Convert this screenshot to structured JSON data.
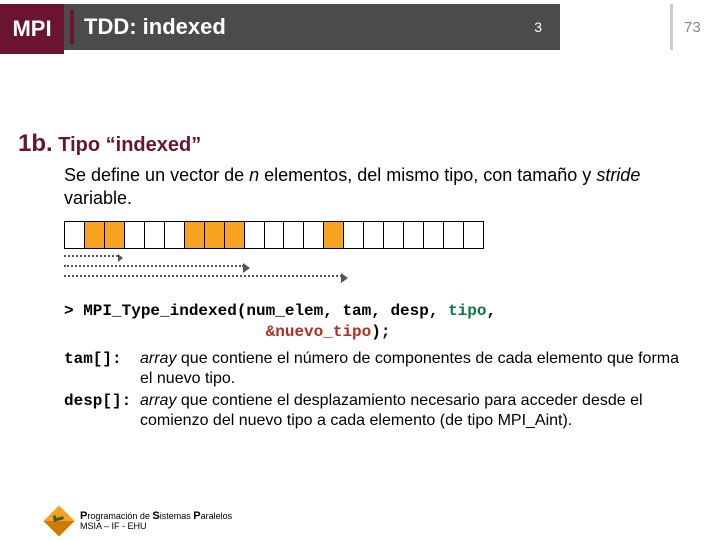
{
  "header": {
    "badge": "MPI",
    "title": "TDD: indexed",
    "page_inner": "3",
    "page_outer": "73"
  },
  "section": {
    "num": "1b.",
    "heading": " Tipo “indexed”",
    "para_before_n": "Se define un vector de ",
    "n": "n",
    "para_mid": " elementos, del mismo tipo, con tamaño y ",
    "stride": "stride",
    "para_after": " variable."
  },
  "code": {
    "line1_a": "> MPI_Type_indexed(num_elem, tam, desp, ",
    "line1_tipo": "tipo",
    "line1_b": ",",
    "line2_pad": "                     ",
    "line2_out": "&nuevo_tipo",
    "line2_b": ");"
  },
  "defs": {
    "tam_label": "tam[]:",
    "tam_array": "array",
    "tam_text": " que contiene el número de componentes de cada elemento que forma el nuevo tipo.",
    "desp_label": "desp[]:",
    "desp_array": "array",
    "desp_text": " que contiene el desplazamiento necesario para acceder desde el comienzo del nuevo tipo a cada elemento (de tipo MPI_Aint)."
  },
  "footer": {
    "line1_P": "P",
    "line1_a": "rogramación de ",
    "line1_S": "S",
    "line1_b": "istemas ",
    "line1_P2": "P",
    "line1_c": "aralelos",
    "line2": "MSIA – IF - EHU"
  },
  "chart_data": {
    "type": "table",
    "title": "indexed blocks layout",
    "cells_total": 21,
    "orange_blocks": [
      {
        "start_index": 1,
        "length": 2
      },
      {
        "start_index": 6,
        "length": 3
      },
      {
        "start_index": 13,
        "length": 1
      }
    ],
    "top_arrows_to_index": [
      1,
      6,
      13
    ],
    "bottom_arrows": [
      {
        "from_index": 0,
        "to_index": 3
      },
      {
        "from_index": 0,
        "to_index": 9
      },
      {
        "from_index": 0,
        "to_index": 14
      }
    ]
  }
}
